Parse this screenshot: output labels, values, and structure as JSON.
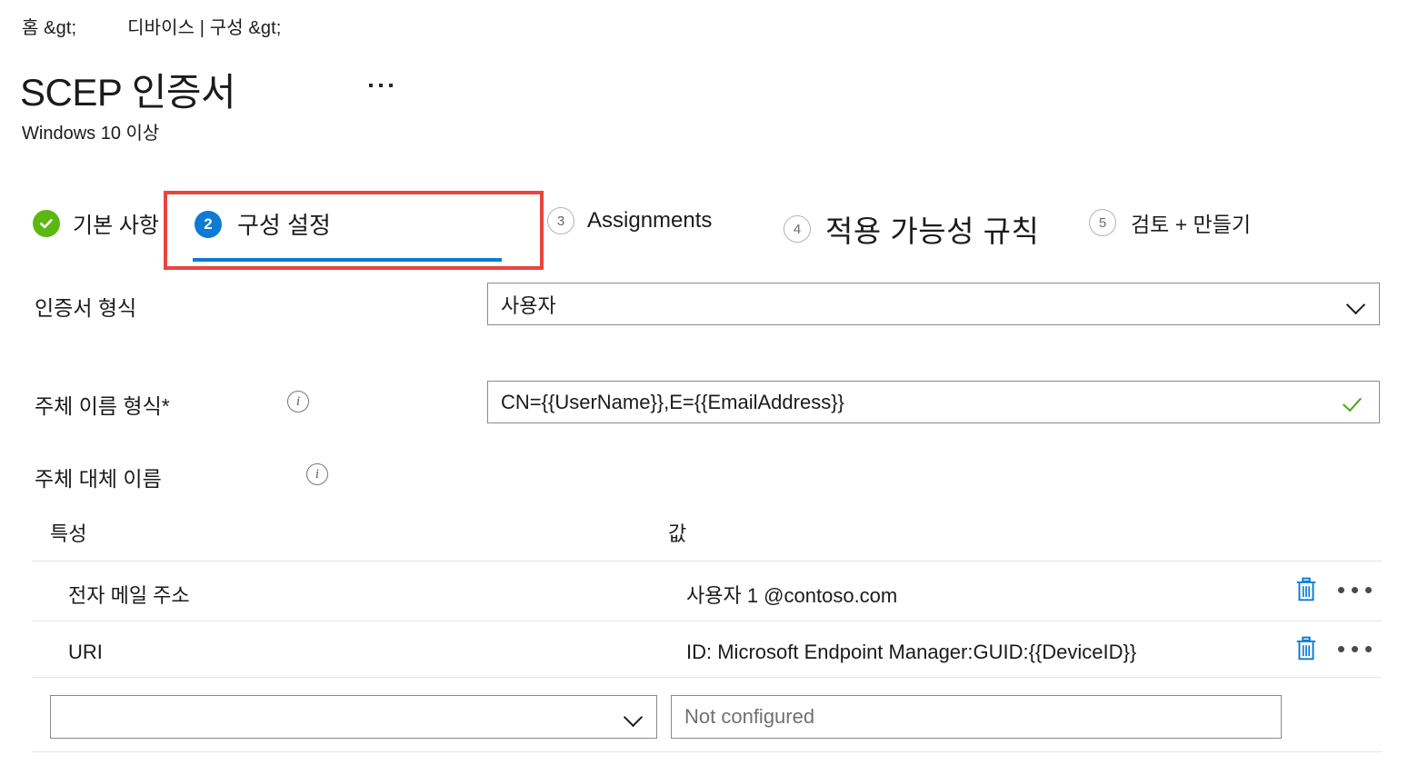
{
  "breadcrumb": {
    "home": "홈 &gt;",
    "section": "디바이스 | 구성 &gt;"
  },
  "header": {
    "title": "SCEP 인증서",
    "subtitle": "Windows 10 이상",
    "more_icon": "ellipsis-icon"
  },
  "wizard": {
    "steps": [
      {
        "number": "1",
        "label": "기본 사항",
        "state": "done",
        "badge_icon": "check-icon"
      },
      {
        "number": "2",
        "label": "구성 설정",
        "state": "current"
      },
      {
        "number": "3",
        "label": "Assignments",
        "state": "upcoming"
      },
      {
        "number": "4",
        "label": "적용 가능성 규칙",
        "state": "upcoming"
      },
      {
        "number": "5",
        "label": "검토 + 만들기",
        "state": "upcoming"
      }
    ],
    "highlight_color": "#E8453C",
    "current_color": "#0B7BD4",
    "done_color": "#5CB811"
  },
  "form": {
    "certificate_type": {
      "label": "인증서 형식",
      "value": "사용자",
      "chevron_icon": "chevron-down-icon"
    },
    "subject_name_format": {
      "label": "주체 이름 형식*",
      "value": "CN={{UserName}},E={{EmailAddress}}",
      "info_icon": "info-icon",
      "valid_icon": "checkmark-icon",
      "valid_color": "#4CA510"
    },
    "subject_alternative_name": {
      "label": "주체 대체 이름",
      "info_icon": "info-icon"
    }
  },
  "table": {
    "columns": [
      "특성",
      "값"
    ],
    "rows": [
      {
        "attribute": "전자 메일 주소",
        "value": "사용자 1 @contoso.com",
        "delete_icon": "trash-icon",
        "more_icon": "ellipsis-icon"
      },
      {
        "attribute": "URI",
        "value": "ID: Microsoft Endpoint Manager:GUID:{{DeviceID}}",
        "delete_icon": "trash-icon",
        "more_icon": "ellipsis-icon"
      }
    ],
    "new_row": {
      "attribute_value": "",
      "attribute_chevron_icon": "chevron-down-icon",
      "value_placeholder": "Not configured"
    },
    "action_color": "#0B7BD4"
  }
}
